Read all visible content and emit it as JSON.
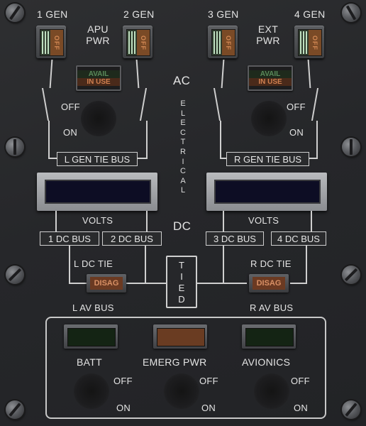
{
  "generators": {
    "g1": {
      "label": "1 GEN",
      "switch_text": "OFF"
    },
    "g2": {
      "label": "2 GEN",
      "switch_text": "OFF"
    },
    "g3": {
      "label": "3 GEN",
      "switch_text": "OFF"
    },
    "g4": {
      "label": "4 GEN",
      "switch_text": "OFF"
    }
  },
  "apu": {
    "label_line1": "APU",
    "label_line2": "PWR",
    "avail": "AVAIL",
    "in_use": "IN USE"
  },
  "ext": {
    "label_line1": "EXT",
    "label_line2": "PWR",
    "avail": "AVAIL",
    "in_use": "IN USE"
  },
  "center": {
    "ac": "AC",
    "dc": "DC",
    "electrical": [
      "E",
      "L",
      "E",
      "C",
      "T",
      "R",
      "I",
      "C",
      "A",
      "L"
    ],
    "tied": [
      "T",
      "I",
      "E",
      "D"
    ]
  },
  "knob_labels": {
    "off": "OFF",
    "on": "ON"
  },
  "buses": {
    "l_gen_tie": "L GEN TIE BUS",
    "r_gen_tie": "R GEN TIE BUS",
    "dc1": "1 DC BUS",
    "dc2": "2 DC BUS",
    "dc3": "3 DC BUS",
    "dc4": "4 DC BUS"
  },
  "volts": "VOLTS",
  "l_dc_tie": {
    "label": "L DC TIE",
    "status": "DISAG",
    "sub": "L AV BUS"
  },
  "r_dc_tie": {
    "label": "R DC TIE",
    "status": "DISAG",
    "sub": "R AV BUS"
  },
  "lower": {
    "batt": "BATT",
    "emerg": "EMERG PWR",
    "avionics": "AVIONICS"
  },
  "colors": {
    "off_amber": "#7a4a26",
    "avail_green": "#5a8a5a",
    "display_blue": "#0d0d24"
  }
}
